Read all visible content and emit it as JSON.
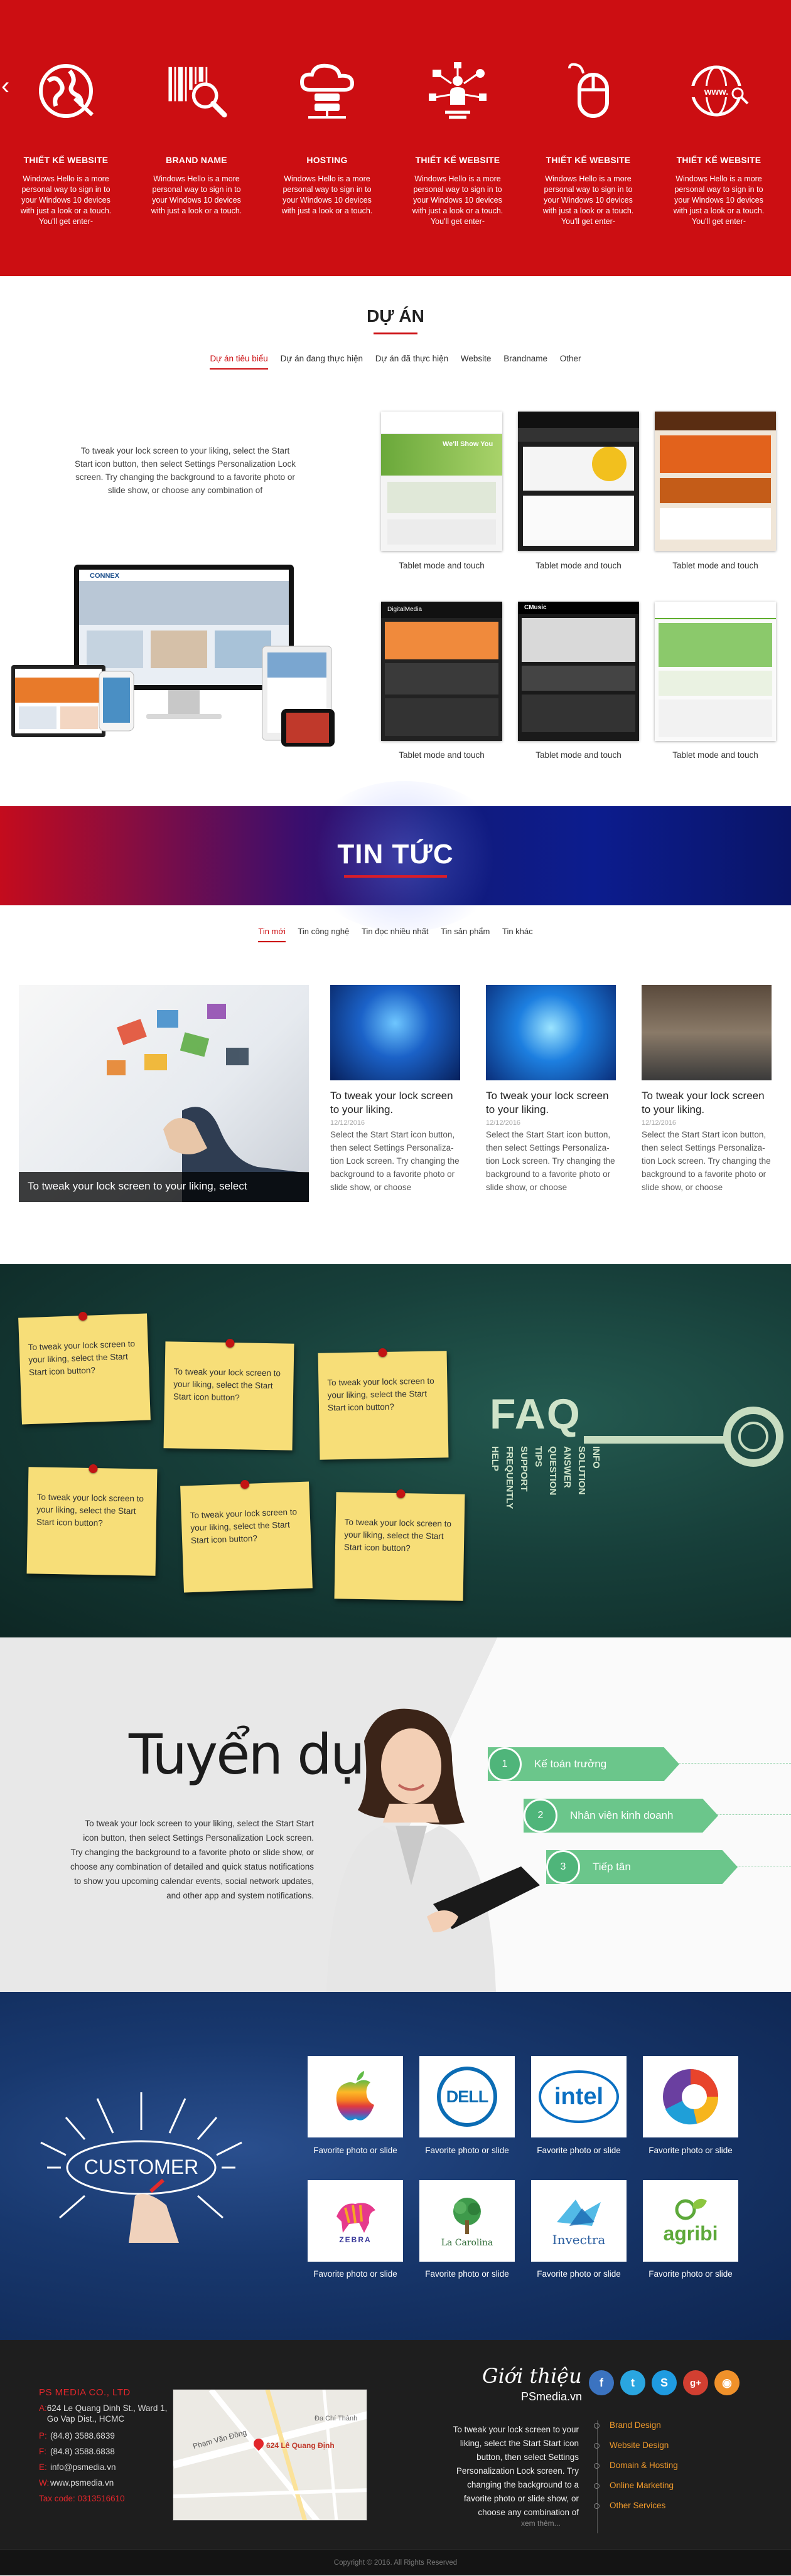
{
  "services": {
    "items": [
      {
        "icon": "globe-icon",
        "title": "THIẾT KẾ WEBSITE",
        "text": "Windows Hello is a more personal way to sign in to your Windows 10 devices with just a look or a touch. You'll get enter-"
      },
      {
        "icon": "barcode-search-icon",
        "title": "BRAND NAME",
        "text": "Windows Hello is a more personal way to sign in to your Windows 10 devices with just a look or a touch."
      },
      {
        "icon": "cloud-server-icon",
        "title": "HOSTING",
        "text": "Windows Hello is a more personal way to sign in to your Windows 10 devices with just a look or a touch."
      },
      {
        "icon": "network-person-icon",
        "title": "THIẾT KẾ WEBSITE",
        "text": "Windows Hello is a more personal way to sign in to your Windows 10 devices with just a look or a touch. You'll get enter-"
      },
      {
        "icon": "mouse-icon",
        "title": "THIẾT KẾ WEBSITE",
        "text": "Windows Hello is a more personal way to sign in to your Windows 10 devices with just a look or a touch. You'll get enter-"
      },
      {
        "icon": "www-search-icon",
        "title": "THIẾT KẾ WEBSITE",
        "text": "Windows Hello is a more personal way to sign in to your Windows 10 devices with just a look or a touch. You'll get enter-"
      }
    ],
    "prev_arrow": "‹"
  },
  "projects": {
    "title": "DỰ ÁN",
    "tabs": [
      "Dự án tiêu biểu",
      "Dự án đang thực hiện",
      "Dự án đã thực hiện",
      "Website",
      "Brandname",
      "Other"
    ],
    "intro": "To tweak your lock screen to your liking, select the Start Start icon button, then select Settings Personalization Lock screen. Try changing the background to a favorite photo or slide show, or choose any combination of",
    "items": [
      {
        "caption": "Tablet mode and touch",
        "thumb_text": "We'll Show You"
      },
      {
        "caption": "Tablet mode and touch",
        "thumb_text": ""
      },
      {
        "caption": "Tablet mode and touch",
        "thumb_text": ""
      },
      {
        "caption": "Tablet mode and touch",
        "thumb_text": "DigitalMedia"
      },
      {
        "caption": "Tablet mode and touch",
        "thumb_text": "CMusic"
      },
      {
        "caption": "Tablet mode and touch",
        "thumb_text": ""
      }
    ],
    "mockup_brand": "CONNEX"
  },
  "news": {
    "banner_title": "TIN TỨC",
    "tabs": [
      "Tin mới",
      "Tin công nghệ",
      "Tin đọc nhiều nhất",
      "Tin sản phẩm",
      "Tin khác"
    ],
    "featured_caption": "To tweak your lock screen to your liking, select",
    "cards": [
      {
        "title": "To tweak your lock screen to your liking.",
        "date": "12/12/2016",
        "text": "Select the Start Start icon button, then select Settings Personaliza-tion Lock screen. Try changing the background to a favorite photo or slide show, or choose"
      },
      {
        "title": "To tweak your lock screen to your liking.",
        "date": "12/12/2016",
        "text": "Select the Start Start icon button, then select Settings Personaliza-tion Lock screen. Try changing the background to a favorite photo or slide show, or choose"
      },
      {
        "title": "To tweak your lock screen to your liking.",
        "date": "12/12/2016",
        "text": "Select the Start Start icon button, then select Settings Personaliza-tion Lock screen. Try changing the background to a favorite photo or slide show, or choose"
      }
    ]
  },
  "faq": {
    "notes": [
      "To tweak your lock screen to your liking, select the Start Start icon button?",
      "To tweak your lock screen to your liking, select the Start Start icon button?",
      "To tweak your lock screen to your liking, select the Start Start icon button?",
      "To tweak your lock screen to your liking, select the Start Start icon button?",
      "To tweak your lock screen to your liking, select the Start Start icon button?",
      "To tweak your lock screen to your liking, select the Start Start icon button?"
    ],
    "key_title": "FAQ",
    "key_words": [
      "INFO",
      "SOLUTION",
      "ANSWER",
      "QUESTION",
      "TIPS",
      "SUPPORT",
      "FREQUENTLY",
      "HELP"
    ]
  },
  "recruit": {
    "title": "Tuyển dụng",
    "text": "To tweak your lock screen to your liking, select the Start Start icon button, then select Settings Personalization Lock screen. Try changing the background to a favorite photo or slide show, or choose any combination of detailed and quick status notifications to show you upcoming calendar events, social network updates, and other app and system notifications.",
    "steps": [
      {
        "num": "1",
        "label": "Kế toán trưởng"
      },
      {
        "num": "2",
        "label": "Nhân viên kinh doanh"
      },
      {
        "num": "3",
        "label": "Tiếp tân"
      }
    ]
  },
  "partners": {
    "customer_label": "CUSTOMER",
    "logos": [
      {
        "name": "apple-logo",
        "text": "",
        "caption": "Favorite photo or slide"
      },
      {
        "name": "dell-logo",
        "text": "DELL",
        "caption": "Favorite photo or slide"
      },
      {
        "name": "intel-logo",
        "text": "intel",
        "caption": "Favorite photo or slide"
      },
      {
        "name": "circle-brand-logo",
        "text": "",
        "caption": "Favorite photo or slide"
      },
      {
        "name": "zebra-logo",
        "text": "ZEBRA",
        "caption": "Favorite photo or slide"
      },
      {
        "name": "lacarolina-logo",
        "text": "La Carolina",
        "caption": "Favorite photo or slide"
      },
      {
        "name": "invectra-logo",
        "text": "Invectra",
        "caption": "Favorite photo or slide"
      },
      {
        "name": "agribi-logo",
        "text": "agribi",
        "caption": "Favorite photo or slide"
      }
    ]
  },
  "footer": {
    "company": "PS MEDIA CO., LTD",
    "address_label": "A:",
    "address": "624 Le Quang Dinh St., Ward 1, Go Vap Dist., HCMC",
    "phone1_label": "P:",
    "phone1": "(84.8) 3588.6839",
    "phone2_label": "F:",
    "phone2": "(84.8) 3588.6838",
    "email_label": "E:",
    "email": "info@psmedia.vn",
    "web_label": "W:",
    "web": "www.psmedia.vn",
    "tax": "Tax code: 0313516610",
    "map_pin_label": "624 Lê Quang Định",
    "map_streets": [
      "Phạm Văn Đồng",
      "Đa Chí Thành"
    ],
    "intro_script": "Giới thiệu",
    "intro_brand": "PSmedia.vn",
    "intro_text": "To tweak your lock screen to your liking, select the Start Start icon button, then select Settings Personalization Lock screen. Try changing the background to a favorite photo or slide show, or choose any combination of",
    "intro_more": "xem thêm...",
    "social": [
      {
        "name": "facebook-icon",
        "glyph": "f",
        "color": "#3b73c0"
      },
      {
        "name": "twitter-icon",
        "glyph": "t",
        "color": "#2aa6e0"
      },
      {
        "name": "skype-icon",
        "glyph": "S",
        "color": "#1f9be0"
      },
      {
        "name": "googleplus-icon",
        "glyph": "g+",
        "color": "#d23f31"
      },
      {
        "name": "rss-icon",
        "glyph": "◉",
        "color": "#f0912a"
      }
    ],
    "services": [
      "Brand Design",
      "Website Design",
      "Domain & Hosting",
      "Online Marketing",
      "Other Services"
    ],
    "copyright": "Copyright © 2016. All Rights Reserved"
  }
}
